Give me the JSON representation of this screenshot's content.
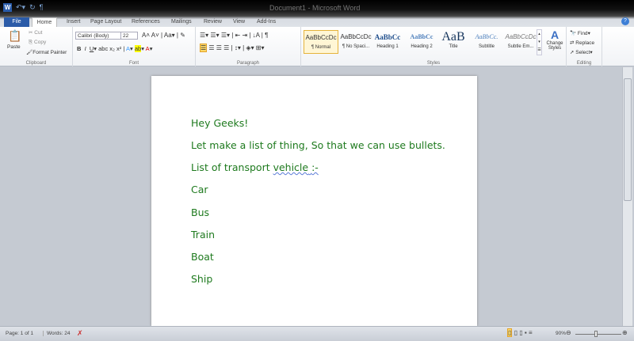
{
  "titlebar": {
    "title": "Document1 - Microsoft Word",
    "app_icon": "W"
  },
  "tabs": [
    "File",
    "Home",
    "Insert",
    "Page Layout",
    "References",
    "Mailings",
    "Review",
    "View",
    "Add-Ins"
  ],
  "clipboard": {
    "paste": "Paste",
    "cut": "Cut",
    "copy": "Copy",
    "format_painter": "Format Painter",
    "label": "Clipboard"
  },
  "font": {
    "name": "Calibri (Body)",
    "size": "22",
    "label": "Font"
  },
  "paragraph": {
    "label": "Paragraph"
  },
  "styles": {
    "items": [
      {
        "preview": "AaBbCcDc",
        "name": "¶ Normal"
      },
      {
        "preview": "AaBbCcDc",
        "name": "¶ No Spaci..."
      },
      {
        "preview": "AaBbCc",
        "name": "Heading 1"
      },
      {
        "preview": "AaBbCc",
        "name": "Heading 2"
      },
      {
        "preview": "AaB",
        "name": "Title"
      },
      {
        "preview": "AaBbCc.",
        "name": "Subtitle"
      },
      {
        "preview": "AaBbCcDc",
        "name": "Subtle Em..."
      }
    ],
    "change": "Change Styles",
    "label": "Styles"
  },
  "editing": {
    "find": "Find",
    "replace": "Replace",
    "select": "Select",
    "label": "Editing"
  },
  "document": {
    "lines": [
      "Hey Geeks!",
      "Let make a list of thing, So that we can use bullets.",
      "List of transport ",
      "vehicle",
      ":-",
      "Car",
      "Bus",
      "Train",
      "Boat",
      "Ship"
    ],
    "text_color": "#1e7a1e"
  },
  "status": {
    "page": "Page: 1 of 1",
    "words": "Words: 24",
    "zoom": "90%",
    "zoom_level_percent": 90
  }
}
